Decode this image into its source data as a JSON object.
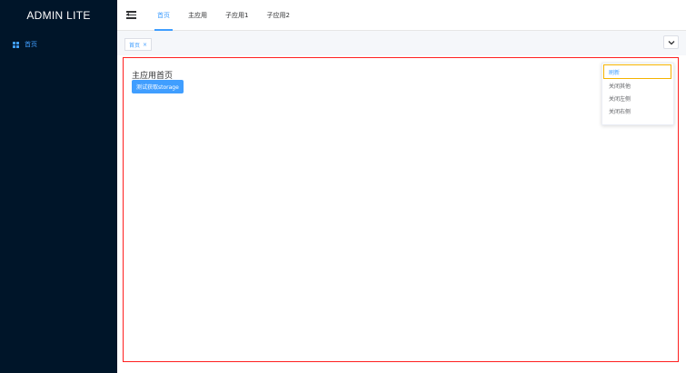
{
  "sidebar": {
    "logo": "ADMIN LITE",
    "items": [
      {
        "label": "首页",
        "icon": "grid-icon",
        "active": true
      }
    ]
  },
  "header": {
    "nav": [
      {
        "label": "首页",
        "active": true
      },
      {
        "label": "主应用",
        "active": false
      },
      {
        "label": "子应用1",
        "active": false
      },
      {
        "label": "子应用2",
        "active": false
      }
    ]
  },
  "tabs": {
    "items": [
      {
        "label": "首页",
        "close": "×"
      }
    ],
    "dropdown_icon": "chevron-down-icon"
  },
  "main": {
    "title": "主应用首页",
    "button_label": "测试获取storage"
  },
  "context_menu": {
    "items": [
      "刷新",
      "关闭其他",
      "关闭左侧",
      "关闭右侧"
    ]
  },
  "colors": {
    "sidebar_bg": "#001529",
    "accent": "#409eff",
    "highlight_border_red": "#ff1f1f",
    "highlight_border_yellow": "#f5b300"
  }
}
